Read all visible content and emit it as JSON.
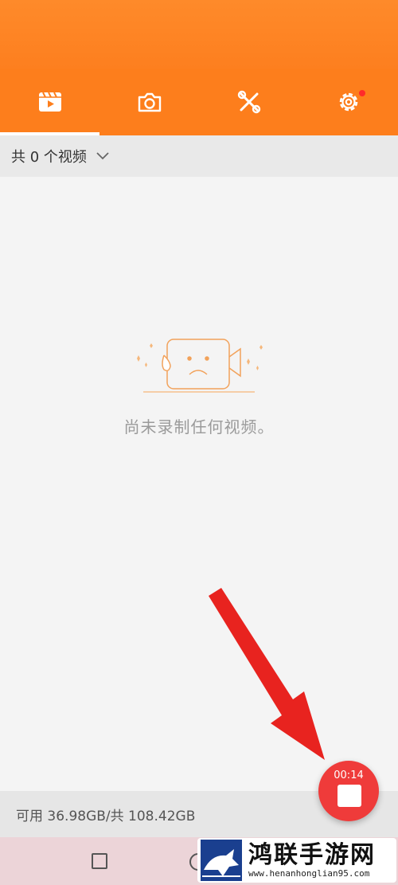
{
  "tabs": [
    {
      "icon": "video-icon",
      "active": true
    },
    {
      "icon": "camera-icon",
      "active": false
    },
    {
      "icon": "tools-icon",
      "active": false
    },
    {
      "icon": "gear-icon",
      "active": false,
      "notification": true
    }
  ],
  "filter": {
    "label": "共 0 个视频"
  },
  "empty_state": {
    "message": "尚未录制任何视频。"
  },
  "storage": {
    "text": "可用 36.98GB/共 108.42GB"
  },
  "recording": {
    "timer": "00:14"
  },
  "watermark": {
    "title": "鸿联手游网",
    "url": "www.henanhonglian95.com"
  },
  "colors": {
    "accent": "#fd7e1c",
    "record": "#ef3b3a",
    "arrow": "#e8231f"
  }
}
